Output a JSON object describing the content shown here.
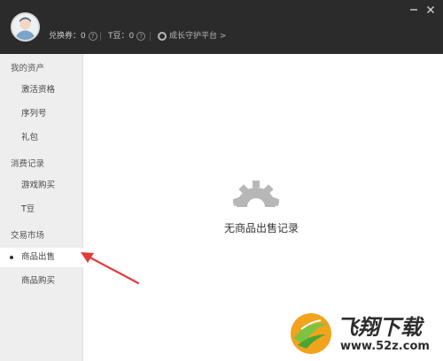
{
  "header": {
    "redeem_label": "兑换券：0",
    "tdou_label": "T豆：0",
    "help_glyph": "?",
    "platform_label": "成长守护平台 >"
  },
  "sidebar": {
    "sections": [
      {
        "title": "我的资产",
        "items": [
          "激活资格",
          "序列号",
          "礼包"
        ]
      },
      {
        "title": "消费记录",
        "items": [
          "游戏购买",
          "T豆"
        ]
      },
      {
        "title": "交易市场",
        "items": [
          "商品出售",
          "商品购买"
        ]
      }
    ],
    "active_item": "商品出售"
  },
  "main": {
    "empty_message": "无商品出售记录"
  },
  "watermark": {
    "title": "飞翔下载",
    "url": "www.52z.com"
  },
  "colors": {
    "titlebar": "#2b2b2b",
    "sidebar": "#eeeeee",
    "arrow": "#e23b3b",
    "icon_gray": "#b7b7b7"
  }
}
